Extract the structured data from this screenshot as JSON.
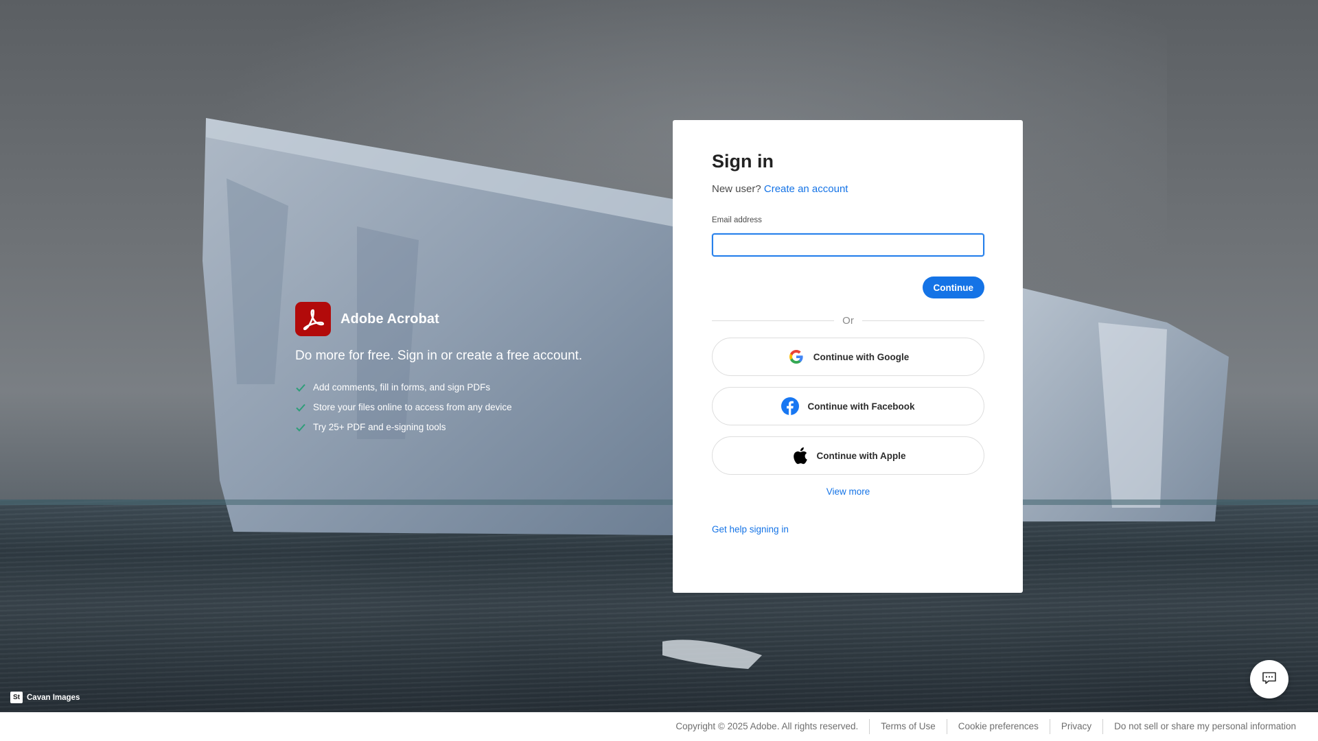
{
  "background": {
    "credit_badge": "St",
    "credit_text": "Cavan Images"
  },
  "promo": {
    "logo_icon": "acrobat-logo-icon",
    "brand_name": "Adobe Acrobat",
    "headline": "Do more for free. Sign in or create a free account.",
    "features": [
      "Add comments, fill in forms, and sign PDFs",
      "Store your files online to access from any device",
      "Try 25+ PDF and e-signing tools"
    ]
  },
  "signin": {
    "title": "Sign in",
    "new_user_prompt": "New user?",
    "create_account_link": "Create an account",
    "email_label": "Email address",
    "email_value": "",
    "continue_label": "Continue",
    "divider_text": "Or",
    "google_label": "Continue with Google",
    "facebook_label": "Continue with Facebook",
    "apple_label": "Continue with Apple",
    "view_more_link": "View more",
    "help_link": "Get help signing in"
  },
  "chat": {
    "icon": "chat-icon"
  },
  "footer": {
    "copyright": "Copyright © 2025 Adobe. All rights reserved.",
    "links": [
      "Terms of Use",
      "Cookie preferences",
      "Privacy",
      "Do not sell or share my personal information"
    ]
  },
  "colors": {
    "accent": "#1473e6",
    "brand_red": "#b20a0a",
    "check_green": "#2d9d78",
    "facebook_blue": "#1877f2"
  }
}
